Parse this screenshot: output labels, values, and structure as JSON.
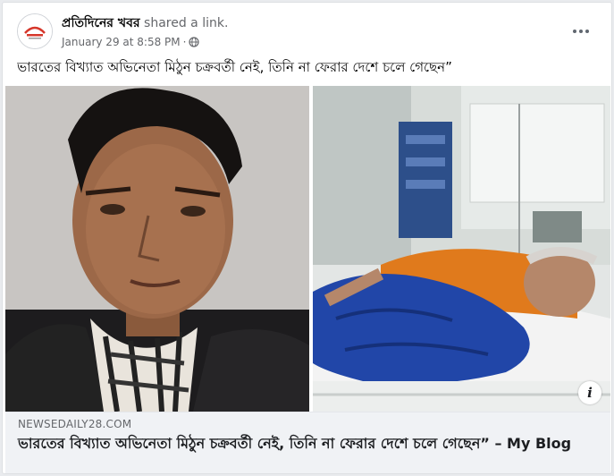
{
  "post": {
    "author": "প্রতিদিনের খবর",
    "action": "shared a link.",
    "date": "January 29 at 8:58 PM",
    "separator": "·",
    "privacy_icon": "globe-icon",
    "more_icon": "more-options-icon",
    "text": "ভারতের বিখ্যাত অভিনেতা মিঠুন চক্রবর্তী নেই, তিনি না ফেরার দেশে চলে গেছেন”"
  },
  "link_preview": {
    "domain": "NEWSEDAILY28.COM",
    "title": "ভারতের বিখ্যাত অভিনেতা মিঠুন চক্রবর্তী নেই, তিনি না ফেরার দেশে চলে গেছেন” – My Blog",
    "info_icon": "info-icon",
    "info_label": "i"
  },
  "colors": {
    "link_bg": "#f0f2f5",
    "hospital_blanket": "#2146a8",
    "patient_shirt": "#e07a1c"
  }
}
